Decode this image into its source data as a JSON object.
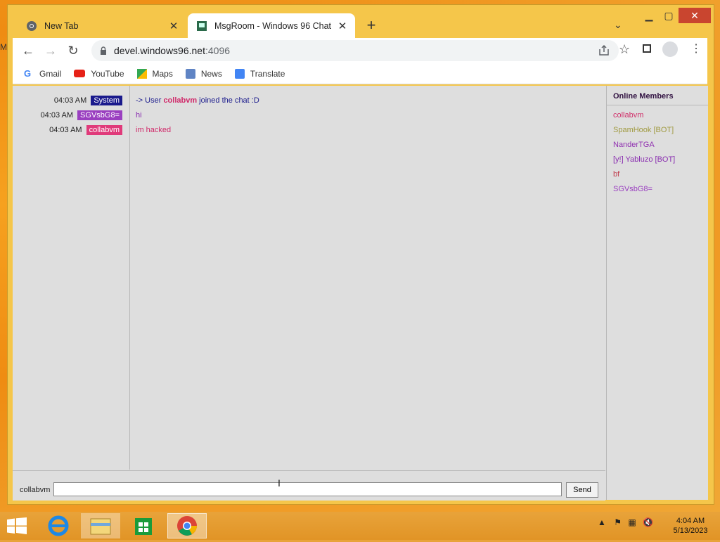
{
  "desktop": {
    "edge_text": "M"
  },
  "browser": {
    "tabs": [
      {
        "title": "New Tab"
      },
      {
        "title": "MsgRoom - Windows 96 Chat"
      }
    ],
    "url_host": "devel.windows96.net",
    "url_port": ":4096",
    "bookmarks": [
      {
        "label": "Gmail",
        "icon": "google-icon"
      },
      {
        "label": "YouTube",
        "icon": "youtube-icon"
      },
      {
        "label": "Maps",
        "icon": "maps-icon"
      },
      {
        "label": "News",
        "icon": "news-icon"
      },
      {
        "label": "Translate",
        "icon": "translate-icon"
      }
    ]
  },
  "chat": {
    "messages": [
      {
        "time": "04:03 AM",
        "user": "System",
        "user_color": "#1a1a8c",
        "prefix": "-> User ",
        "highlight": "collabvm",
        "suffix": " joined the chat :D",
        "text_color": "#1a1a8c"
      },
      {
        "time": "04:03 AM",
        "user": "SGVsbG8=",
        "user_color": "#9a3fc0",
        "text": "hi",
        "text_color": "#8a2fb0"
      },
      {
        "time": "04:03 AM",
        "user": "collabvm",
        "user_color": "#e03a7a",
        "text": "im hacked",
        "text_color": "#d02a6a"
      }
    ],
    "members_title": "Online Members",
    "members": [
      {
        "name": "collabvm",
        "color": "#d0306a"
      },
      {
        "name": "SpamHook [BOT]",
        "color": "#a09a40"
      },
      {
        "name": "NanderTGA",
        "color": "#9030b0"
      },
      {
        "name": "[y!] Yabluzo [BOT]",
        "color": "#8a2fb0"
      },
      {
        "name": "bf",
        "color": "#c04050"
      },
      {
        "name": "SGVsbG8=",
        "color": "#9a3fc0"
      }
    ],
    "nickname": "collabvm",
    "input_value": "",
    "send_label": "Send"
  },
  "taskbar": {
    "time": "4:04 AM",
    "date": "5/13/2023"
  }
}
